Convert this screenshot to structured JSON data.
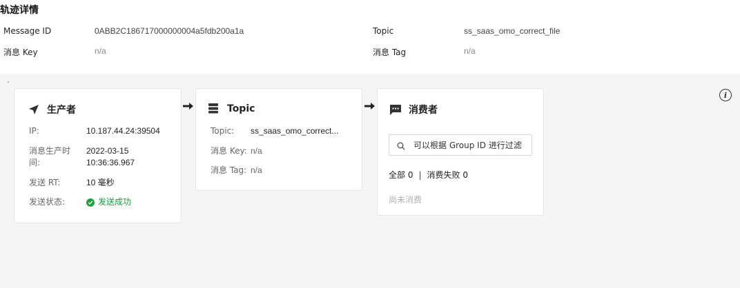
{
  "page_title": "轨迹详情",
  "meta": {
    "message_id_label": "Message ID",
    "message_id_value": "0ABB2C186717000000004a5fdb200a1a",
    "topic_label": "Topic",
    "topic_value": "ss_saas_omo_correct_file",
    "key_label": "消息 Key",
    "key_value": "n/a",
    "tag_label": "消息 Tag",
    "tag_value": "n/a"
  },
  "producer": {
    "title": "生产者",
    "icon": "send-icon",
    "ip_label": "IP:",
    "ip_value": "10.187.44.24:39504",
    "time_label_line1": "消息生产时",
    "time_label_line2": "间:",
    "time_value_line1": "2022-03-15",
    "time_value_line2": "10:36:36.967",
    "rt_label": "发送 RT:",
    "rt_value": "10 毫秒",
    "status_label": "发送状态:",
    "status_value": "发送成功",
    "status_color": "#1fa33d"
  },
  "topic_card": {
    "title": "Topic",
    "icon": "server-icon",
    "topic_label": "Topic:",
    "topic_value": "ss_saas_omo_correct...",
    "key_label": "消息 Key:",
    "key_value": "n/a",
    "tag_label": "消息 Tag:",
    "tag_value": "n/a"
  },
  "consumer": {
    "title": "消费者",
    "icon": "message-icon",
    "search_placeholder": "可以根据 Group ID 进行过滤",
    "all_label": "全部 0",
    "separator": "|",
    "failed_label": "消费失败 0",
    "empty_text": "尚未消费"
  },
  "info_icon": "info-icon"
}
